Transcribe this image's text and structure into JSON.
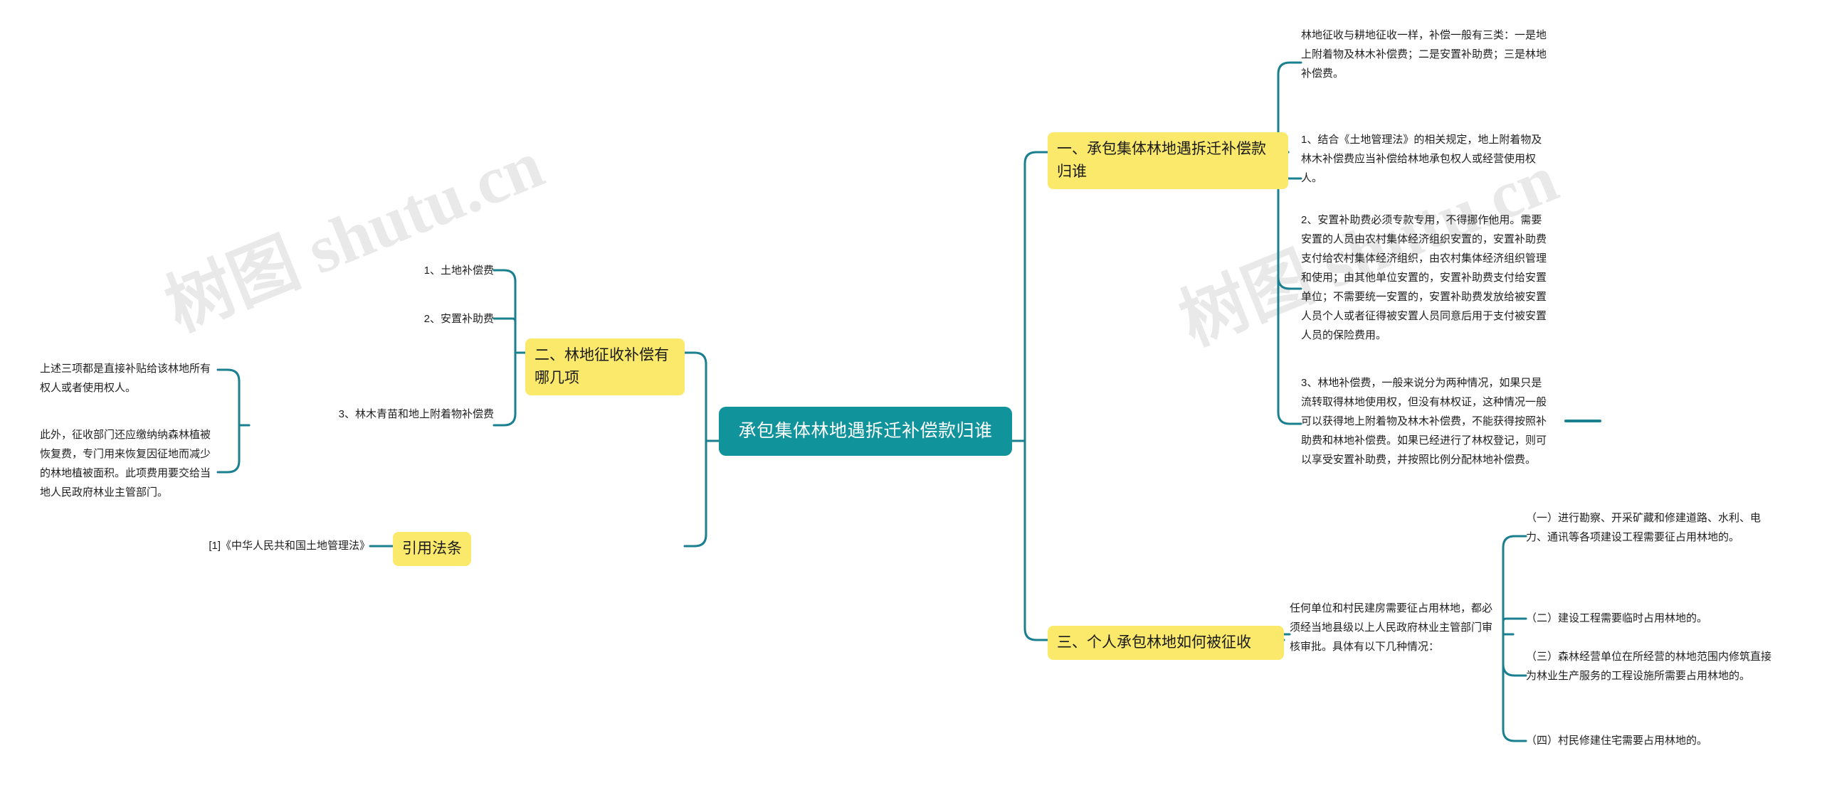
{
  "diagram": {
    "type": "mindmap",
    "watermark": "树图 shutu.cn",
    "colors": {
      "root_fill": "#11939c",
      "root_text": "#ffffff",
      "branch_fill": "#fae96a",
      "branch_text": "#1a1a1a",
      "connector": "#1a7f8e",
      "leaf_text": "#1f1f1f",
      "background": "#ffffff"
    },
    "root": {
      "label": "承包集体林地遇拆迁补偿款归谁"
    },
    "branches": [
      {
        "id": "branch-1",
        "label": "一、承包集体林地遇拆迁补偿款归谁",
        "children": [
          {
            "id": "b1-c1",
            "text": "林地征收与耕地征收一样，补偿一般有三类：一是地上附着物及林木补偿费；二是安置补助费；三是林地补偿费。"
          },
          {
            "id": "b1-c2",
            "text": "1、结合《土地管理法》的相关规定，地上附着物及林木补偿费应当补偿给林地承包权人或经营使用权人。"
          },
          {
            "id": "b1-c3",
            "text": "2、安置补助费必须专款专用，不得挪作他用。需要安置的人员由农村集体经济组织安置的，安置补助费支付给农村集体经济组织，由农村集体经济组织管理和使用；由其他单位安置的，安置补助费支付给安置单位；不需要统一安置的，安置补助费发放给被安置人员个人或者征得被安置人员同意后用于支付被安置人员的保险费用。"
          },
          {
            "id": "b1-c4",
            "text": "3、林地补偿费，一般来说分为两种情况，如果只是流转取得林地使用权，但没有林权证，这种情况一般可以获得地上附着物及林木补偿费，不能获得按照补助费和林地补偿费。如果已经进行了林权登记，则可以享受安置补助费，并按照比例分配林地补偿费。"
          }
        ]
      },
      {
        "id": "branch-2",
        "label": "二、林地征收补偿有哪几项",
        "children": [
          {
            "id": "b2-c1",
            "text": "1、土地补偿费"
          },
          {
            "id": "b2-c2",
            "text": "2、安置补助费"
          },
          {
            "id": "b2-c3",
            "text": "3、林木青苗和地上附着物补偿费",
            "children": [
              {
                "id": "b2-c3-d1",
                "text": "上述三项都是直接补贴给该林地所有权人或者使用权人。"
              },
              {
                "id": "b2-c3-d2",
                "text": "此外，征收部门还应缴纳纳森林植被恢复费，专门用来恢复因征地而减少的林地植被面积。此项费用要交给当地人民政府林业主管部门。"
              }
            ]
          }
        ]
      },
      {
        "id": "branch-3",
        "label": "引用法条",
        "children": [
          {
            "id": "b3-c1",
            "text": "[1]《中华人民共和国土地管理法》"
          }
        ]
      },
      {
        "id": "branch-4",
        "label": "三、个人承包林地如何被征收",
        "children": [
          {
            "id": "b4-c1",
            "text": "任何单位和村民建房需要征占用林地，都必须经当地县级以上人民政府林业主管部门审核审批。具体有以下几种情况：",
            "children": [
              {
                "id": "b4-c1-d1",
                "text": "（一）进行勘察、开采矿藏和修建道路、水利、电力、通讯等各项建设工程需要征占用林地的。"
              },
              {
                "id": "b4-c1-d2",
                "text": "（二）建设工程需要临时占用林地的。"
              },
              {
                "id": "b4-c1-d3",
                "text": "（三）森林经营单位在所经营的林地范围内修筑直接为林业生产服务的工程设施所需要占用林地的。"
              },
              {
                "id": "b4-c1-d4",
                "text": "（四）村民修建住宅需要占用林地的。"
              }
            ]
          }
        ]
      }
    ]
  }
}
